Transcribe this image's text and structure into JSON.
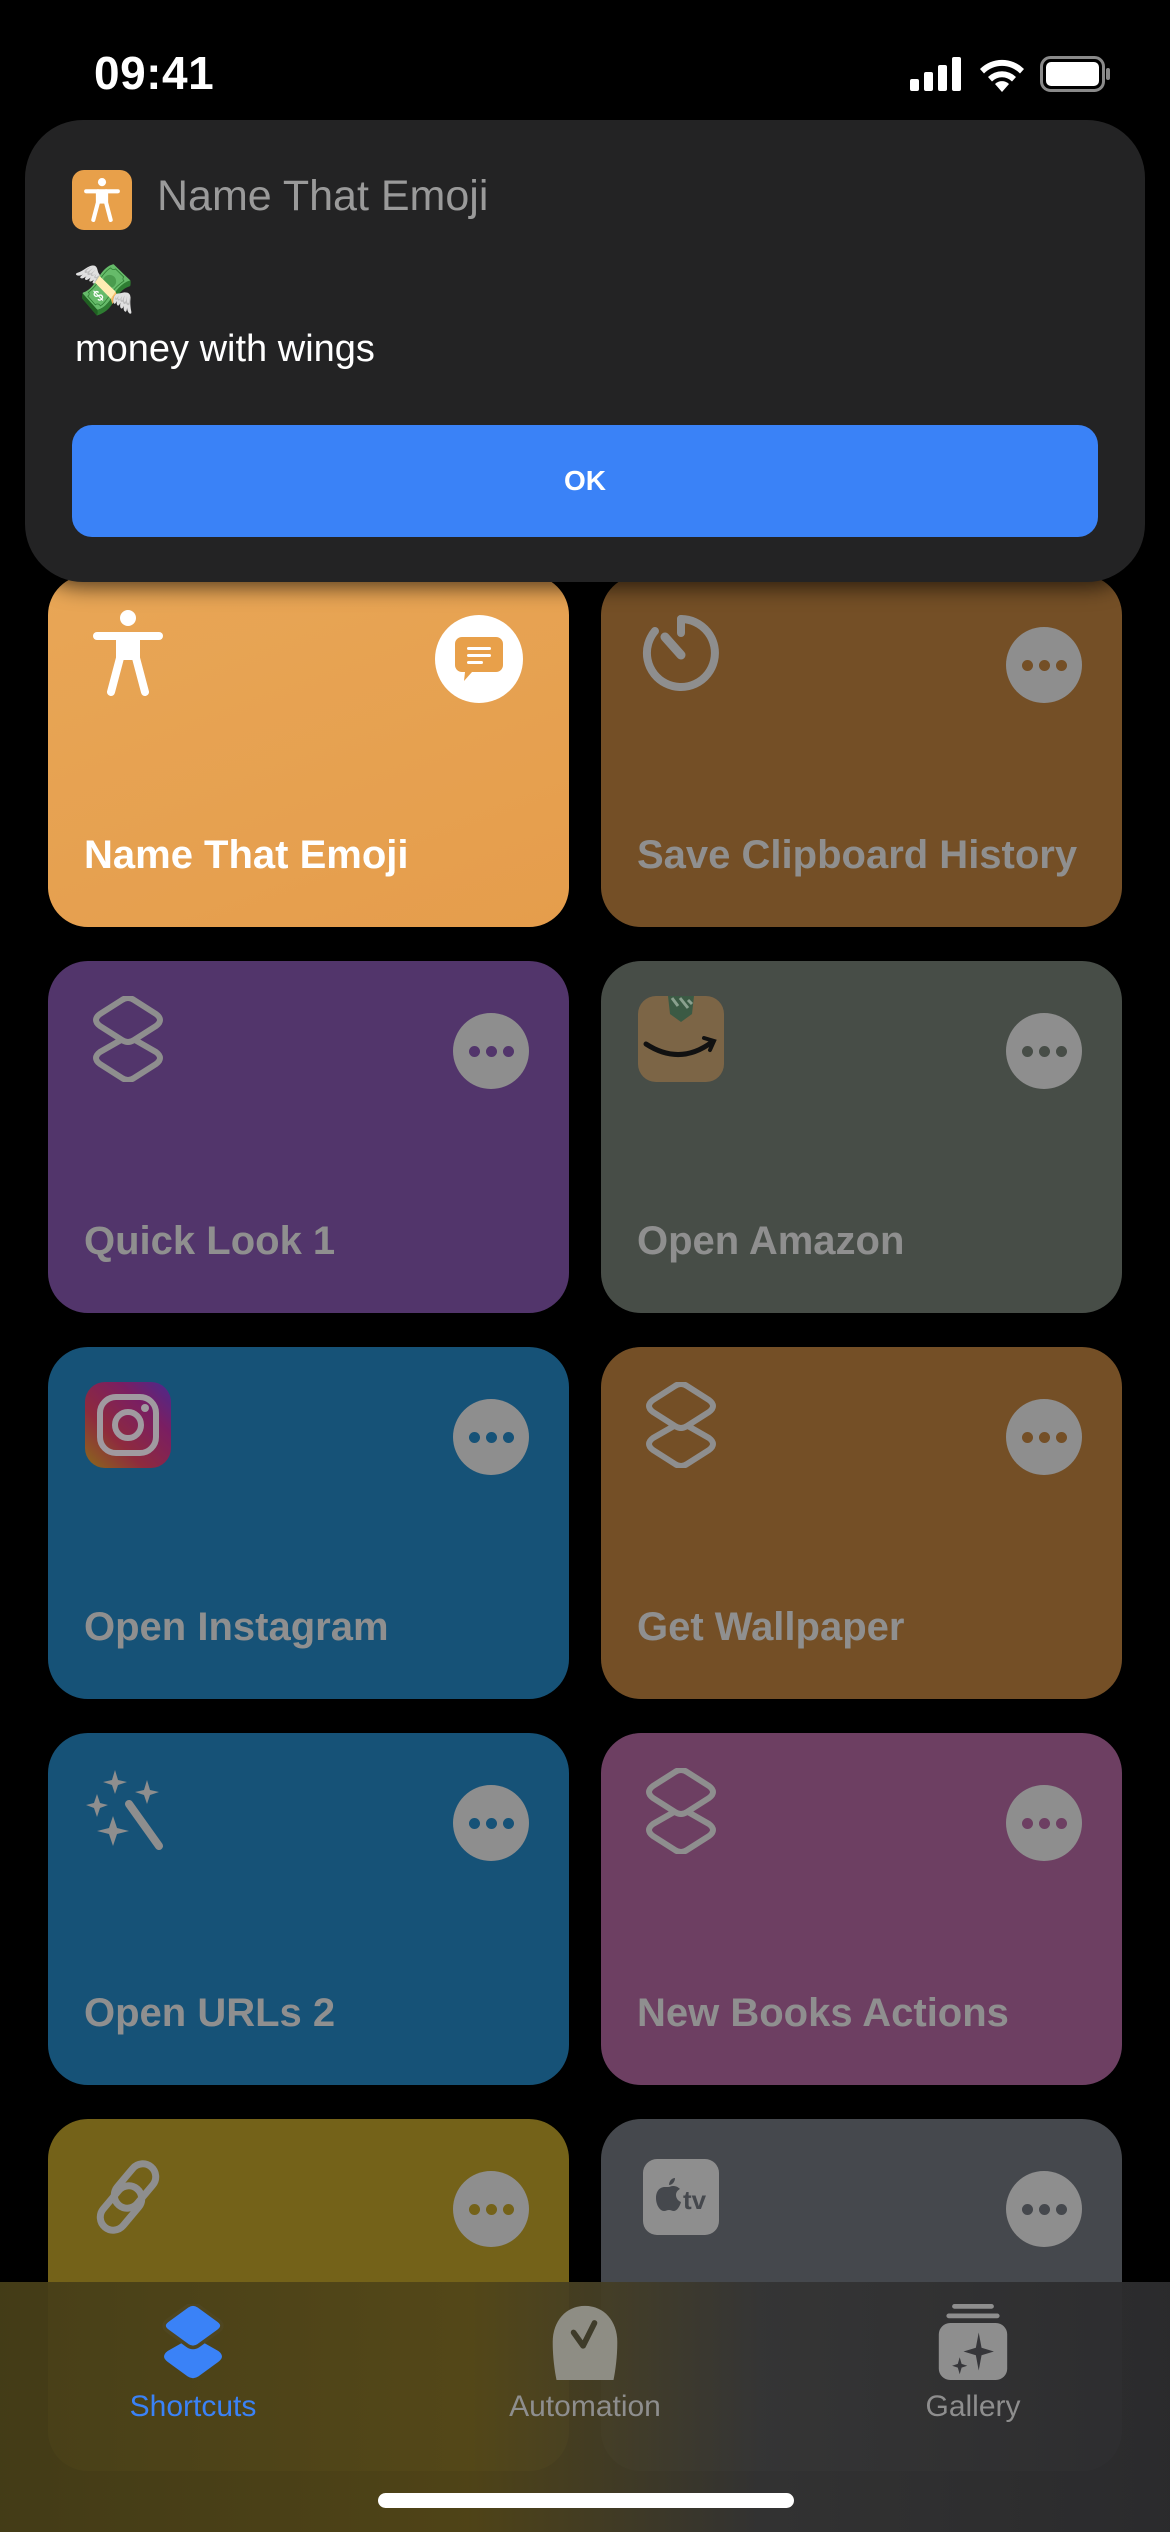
{
  "status_bar": {
    "time": "09:41",
    "icons": [
      "cellular-signal-icon",
      "wifi-icon",
      "battery-icon"
    ]
  },
  "alert": {
    "app_icon": "accessibility-person-icon",
    "app_color": "#e8a04a",
    "title": "Name That Emoji",
    "emoji": "💸",
    "message": "money with wings",
    "ok_label": "OK",
    "button_color": "#3a82f7"
  },
  "shortcuts": [
    {
      "title": "Name That Emoji",
      "icon": "accessibility-person-icon",
      "color": "#e8a14f",
      "active": true,
      "action_icon": "speech-bubble-icon"
    },
    {
      "title": "Save Clipboard History",
      "icon": "timer-icon",
      "color": "#744f26",
      "active": false,
      "action_icon": "more-icon"
    },
    {
      "title": "Quick Look 1",
      "icon": "shortcuts-layers-icon",
      "color": "#52356b",
      "active": false,
      "action_icon": "more-icon"
    },
    {
      "title": "Open Amazon",
      "icon": "amazon-app-icon",
      "color": "#474d47",
      "active": false,
      "action_icon": "more-icon"
    },
    {
      "title": "Open Instagram",
      "icon": "instagram-app-icon",
      "color": "#165277",
      "active": false,
      "action_icon": "more-icon"
    },
    {
      "title": "Get Wallpaper",
      "icon": "shortcuts-layers-icon",
      "color": "#744f26",
      "active": false,
      "action_icon": "more-icon"
    },
    {
      "title": "Open URLs 2",
      "icon": "magic-wand-icon",
      "color": "#165277",
      "active": false,
      "action_icon": "more-icon"
    },
    {
      "title": "New Books Actions",
      "icon": "shortcuts-layers-icon",
      "color": "#6d3f62",
      "active": false,
      "action_icon": "more-icon"
    },
    {
      "title": "",
      "icon": "link-icon",
      "color": "#746219",
      "active": false,
      "action_icon": "more-icon"
    },
    {
      "title": "",
      "icon": "apple-tv-app-icon",
      "color": "#45484d",
      "active": false,
      "action_icon": "more-icon"
    }
  ],
  "tab_bar": {
    "tabs": [
      {
        "label": "Shortcuts",
        "icon": "shortcuts-layers-icon",
        "selected": true
      },
      {
        "label": "Automation",
        "icon": "automation-clock-check-icon",
        "selected": false
      },
      {
        "label": "Gallery",
        "icon": "gallery-sparkle-stack-icon",
        "selected": false
      }
    ],
    "accent_color": "#3a82f7"
  }
}
